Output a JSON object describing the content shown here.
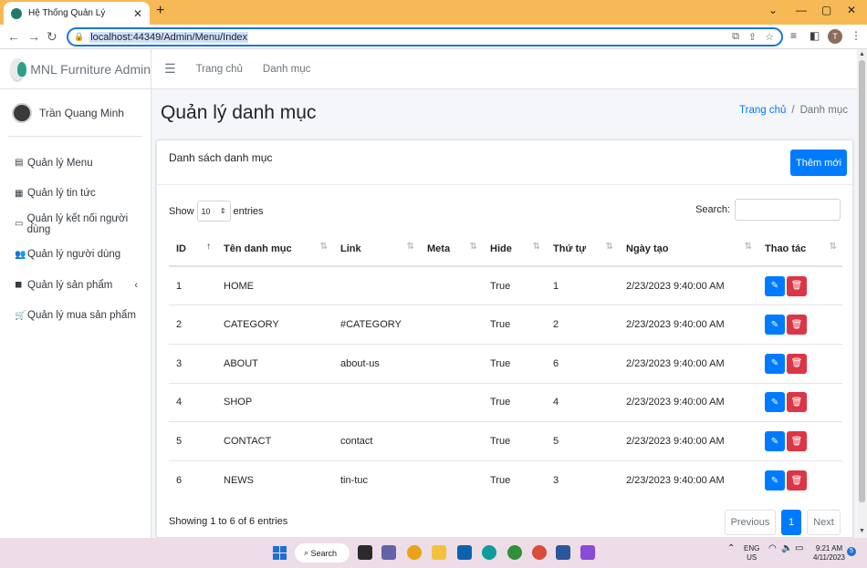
{
  "browser": {
    "tab_title": "Hệ Thống Quản Lý",
    "tab_close": "✕",
    "new_tab": "+",
    "url": "localhost:44349/Admin/Menu/Index",
    "profile_initial": "T"
  },
  "sidebar": {
    "brand": "MNL Furniture Admin",
    "user_name": "Trần Quang Minh",
    "items": [
      {
        "label": "Quản lý Menu",
        "icon": "table-icon"
      },
      {
        "label": "Quản lý tin tức",
        "icon": "newspaper-icon"
      },
      {
        "label": "Quản lý kết nối người dùng",
        "icon": "file-icon"
      },
      {
        "label": "Quản lý người dùng",
        "icon": "users-icon"
      },
      {
        "label": "Quản lý sản phẩm",
        "icon": "box-icon"
      },
      {
        "label": "Quản lý mua sản phẩm",
        "icon": "cart-icon"
      }
    ]
  },
  "topnav": {
    "home": "Trang chủ",
    "category": "Danh mục"
  },
  "page": {
    "title": "Quản lý danh mục",
    "breadcrumb_home": "Trang chủ",
    "breadcrumb_sep": "/",
    "breadcrumb_current": "Danh mục"
  },
  "card": {
    "title": "Danh sách danh mục",
    "add_button": "Thêm mới",
    "show_label": "Show",
    "length_value": "10",
    "entries_label": "entries",
    "search_label": "Search:",
    "info": "Showing 1 to 6 of 6 entries",
    "prev": "Previous",
    "page": "1",
    "next": "Next"
  },
  "table": {
    "headers": [
      "ID",
      "Tên danh mục",
      "Link",
      "Meta",
      "Hide",
      "Thứ tự",
      "Ngày tạo",
      "Thao tác"
    ],
    "rows": [
      [
        "1",
        "HOME",
        "",
        "",
        "True",
        "1",
        "2/23/2023 9:40:00 AM"
      ],
      [
        "2",
        "CATEGORY",
        "#CATEGORY",
        "",
        "True",
        "2",
        "2/23/2023 9:40:00 AM"
      ],
      [
        "3",
        "ABOUT",
        "about-us",
        "",
        "True",
        "6",
        "2/23/2023 9:40:00 AM"
      ],
      [
        "4",
        "SHOP",
        "",
        "",
        "True",
        "4",
        "2/23/2023 9:40:00 AM"
      ],
      [
        "5",
        "CONTACT",
        "contact",
        "",
        "True",
        "5",
        "2/23/2023 9:40:00 AM"
      ],
      [
        "6",
        "NEWS",
        "tin-tuc",
        "",
        "True",
        "3",
        "2/23/2023 9:40:00 AM"
      ]
    ]
  },
  "taskbar": {
    "search": "Search",
    "lang_top": "ENG",
    "lang_bottom": "US",
    "time": "9:21 AM",
    "date": "4/11/2023",
    "notif": "5"
  },
  "colors": {
    "primary": "#007bff",
    "danger": "#dc3545",
    "tabbar": "#f7b955"
  }
}
